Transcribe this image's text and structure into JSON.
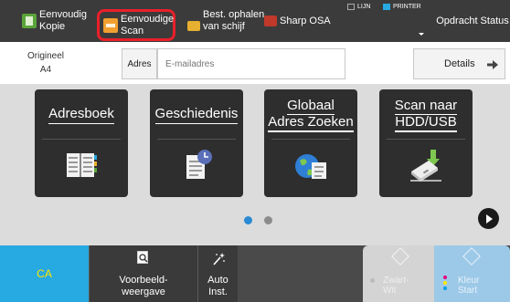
{
  "topbar": {
    "modes": [
      {
        "line1": "Eenvoudig",
        "line2": "Kopie"
      },
      {
        "line1": "Eenvoudige",
        "line2": "Scan"
      },
      {
        "line1": "Best. ophalen",
        "line2": "van schijf"
      },
      {
        "line1": "Sharp OSA",
        "line2": ""
      }
    ],
    "indicator_line": "LIJN",
    "indicator_printer": "PRINTER",
    "operation_status": "Opdracht Status"
  },
  "address_row": {
    "original_label": "Origineel",
    "original_size": "A4",
    "address_label": "Adres",
    "address_placeholder": "E-mailadres",
    "details_label": "Details"
  },
  "tiles": [
    {
      "line1": "Adresboek",
      "line2": "",
      "icon": "address-book-icon"
    },
    {
      "line1": "Geschiedenis",
      "line2": "",
      "icon": "history-icon"
    },
    {
      "line1": "Globaal",
      "line2": "Adres Zoeken",
      "icon": "global-search-icon"
    },
    {
      "line1": "Scan naar",
      "line2": "HDD/USB",
      "icon": "hdd-usb-icon"
    }
  ],
  "pagination": {
    "current_page": 1,
    "total_pages": 2
  },
  "bottombar": {
    "ca_label": "CA",
    "preview_line1": "Voorbeeld-",
    "preview_line2": "weergave",
    "auto_label": "Auto Inst.",
    "bw_start_line1": "Zwart-",
    "bw_start_line2": "Wit",
    "color_start_line1": "Kleur",
    "color_start_line2": "Start"
  },
  "colors": {
    "highlight_border": "#e8202a",
    "ca_background": "#27a9e1",
    "ca_text": "#ffe600",
    "page_dot_active": "#2a8ad4"
  }
}
